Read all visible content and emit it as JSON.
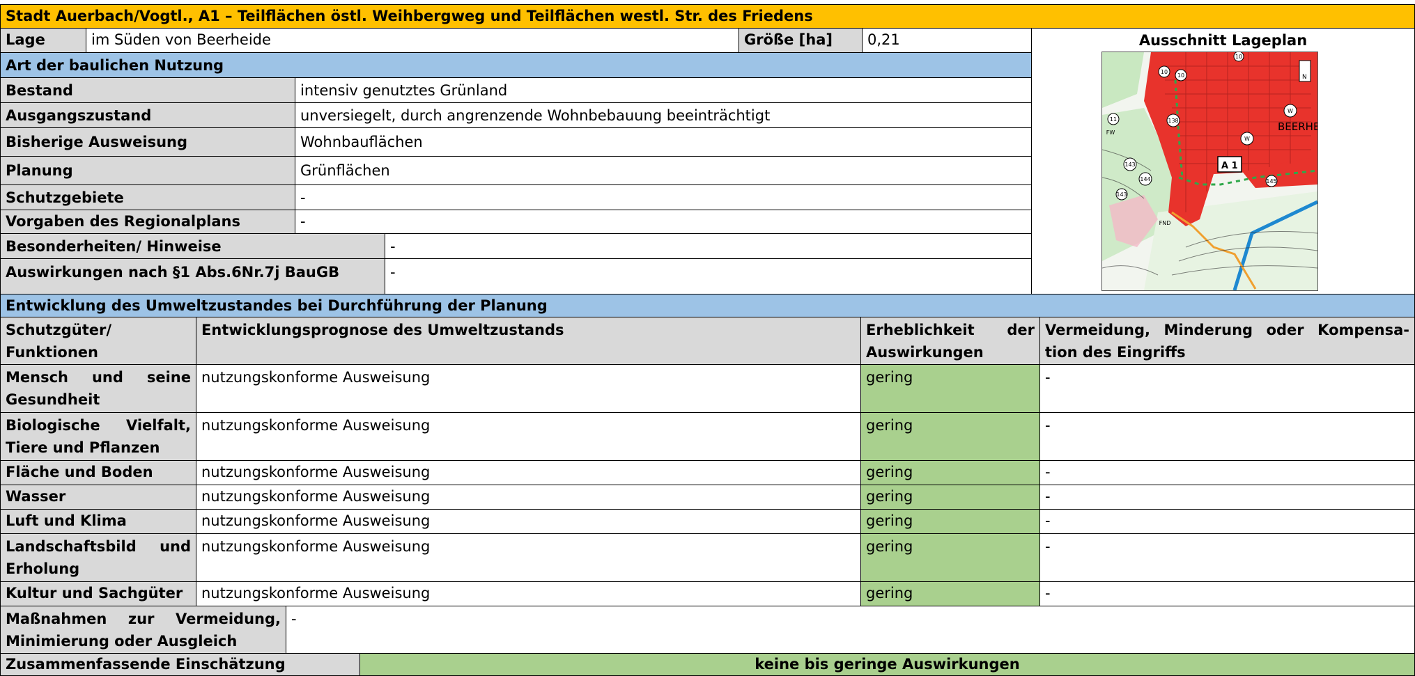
{
  "title": "Stadt Auerbach/Vogtl., A1 – Teilflächen östl. Weihbergweg und Teilflächen westl. Str. des Friedens",
  "top": {
    "lage_label": "Lage",
    "lage_value": "im Süden von Beerheide",
    "groesse_label": "Größe [ha]",
    "groesse_value": "0,21",
    "map_label": "Ausschnitt Lageplan"
  },
  "map": {
    "labels": [
      "A 1",
      "BEERHE",
      "N",
      "W",
      "W",
      "FW",
      "FND",
      "10",
      "10",
      "10",
      "11",
      "138",
      "143",
      "143",
      "144",
      "145"
    ]
  },
  "nutzung": {
    "header": "Art der baulichen Nutzung",
    "rows": [
      {
        "label": "Bestand",
        "value": "intensiv genutztes Grünland"
      },
      {
        "label": "Ausgangszustand",
        "value": "unversiegelt, durch angrenzende Wohnbebauung beeinträchtigt"
      },
      {
        "label": "Bisherige Ausweisung",
        "value": "Wohnbauflächen"
      },
      {
        "label": "Planung",
        "value": "Grünflächen"
      },
      {
        "label": "Schutzgebiete",
        "value": "-"
      },
      {
        "label": "Vorgaben des Regionalplans",
        "value": "-"
      },
      {
        "label": "Besonderheiten/ Hinweise",
        "value": "-"
      },
      {
        "label": "Auswirkungen nach §1 Abs.6Nr.7j BauGB",
        "value": "-"
      }
    ]
  },
  "entwicklung": {
    "header": "Entwicklung des Umweltzustandes bei Durchführung der Planung",
    "col1_a": "Schutzgüter/",
    "col1_b": "Funktionen",
    "col2": "Entwicklungsprognose des Umweltzustands",
    "col3_a1": "Erheblichkeit",
    "col3_a2": "der",
    "col3_b": "Auswirkungen",
    "col4_a": "Vermeidung, Minderung oder Kompensa-",
    "col4_b": "tion des Eingriffs",
    "rows": [
      {
        "name_a": "Mensch und seine",
        "name_b": "Gesundheit",
        "prognose": "nutzungskonforme Ausweisung",
        "erheblichkeit": "gering",
        "massnahme": "-"
      },
      {
        "name_a": "Biologische Vielfalt,",
        "name_b": "Tiere und Pflanzen",
        "prognose": "nutzungskonforme Ausweisung",
        "erheblichkeit": "gering",
        "massnahme": "-"
      },
      {
        "name_a": "Fläche und Boden",
        "prognose": "nutzungskonforme Ausweisung",
        "erheblichkeit": "gering",
        "massnahme": "-"
      },
      {
        "name_a": "Wasser",
        "prognose": "nutzungskonforme Ausweisung",
        "erheblichkeit": "gering",
        "massnahme": "-"
      },
      {
        "name_a": "Luft und Klima",
        "prognose": "nutzungskonforme Ausweisung",
        "erheblichkeit": "gering",
        "massnahme": "-"
      },
      {
        "name_a": "Landschaftsbild und",
        "name_b": "Erholung",
        "prognose": "nutzungskonforme Ausweisung",
        "erheblichkeit": "gering",
        "massnahme": "-"
      },
      {
        "name_a": "Kultur und Sachgüter",
        "prognose": "nutzungskonforme Ausweisung",
        "erheblichkeit": "gering",
        "massnahme": "-"
      }
    ]
  },
  "massnahmen": {
    "label_a": "Maßnahmen zur Vermeidung,",
    "label_b": "Minimierung oder Ausgleich",
    "value": "-"
  },
  "zusammenfassung": {
    "label": "Zusammenfassende Einschätzung",
    "value": "keine bis geringe Auswirkungen"
  },
  "colors": {
    "title": "#ffc000",
    "section": "#9dc3e6",
    "label": "#d9d9d9",
    "rating": "#a9d08e"
  }
}
